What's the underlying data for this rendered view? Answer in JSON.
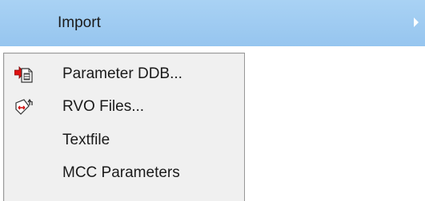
{
  "menu": {
    "parent": {
      "label": "Import",
      "arrow_icon": "submenu-arrow-icon",
      "highlight_color": "#9fcbf1"
    },
    "items": [
      {
        "label": "Parameter DDB...",
        "icon": "parameter-ddb-import-icon"
      },
      {
        "label": "RVO Files...",
        "icon": "rvo-files-icon"
      },
      {
        "label": "Textfile",
        "icon": ""
      },
      {
        "label": "MCC Parameters",
        "icon": ""
      }
    ]
  }
}
